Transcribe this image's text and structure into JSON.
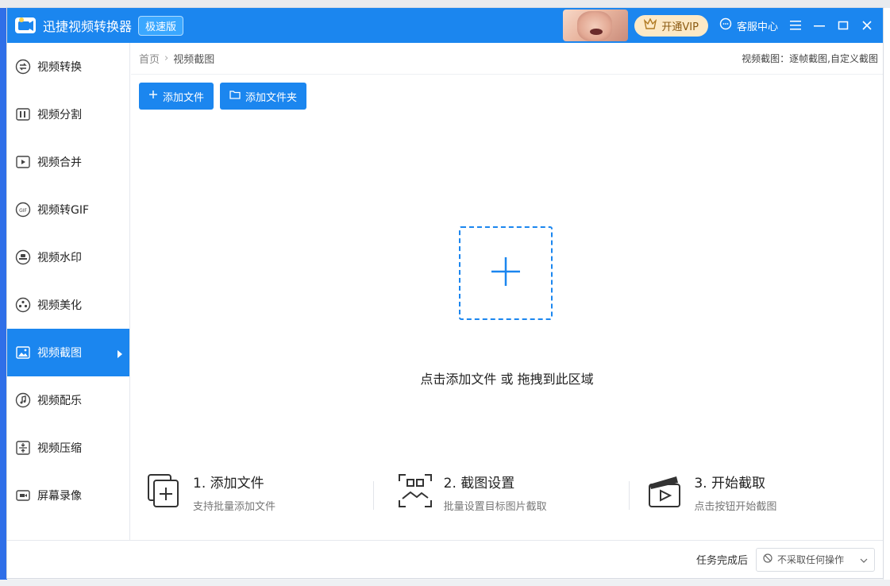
{
  "app": {
    "title": "迅捷视频转换器",
    "badge": "极速版",
    "vip_label": "开通VIP",
    "service_label": "客服中心"
  },
  "sidebar": {
    "items": [
      {
        "label": "视频转换",
        "icon": "convert-icon"
      },
      {
        "label": "视频分割",
        "icon": "split-icon"
      },
      {
        "label": "视频合并",
        "icon": "merge-icon"
      },
      {
        "label": "视频转GIF",
        "icon": "gif-icon"
      },
      {
        "label": "视频水印",
        "icon": "watermark-icon"
      },
      {
        "label": "视频美化",
        "icon": "beautify-icon"
      },
      {
        "label": "视频截图",
        "icon": "screenshot-icon",
        "active": true
      },
      {
        "label": "视频配乐",
        "icon": "music-icon"
      },
      {
        "label": "视频压缩",
        "icon": "compress-icon"
      },
      {
        "label": "屏幕录像",
        "icon": "record-icon"
      }
    ]
  },
  "breadcrumb": {
    "home": "首页",
    "current": "视频截图",
    "right_info": "视频截图：逐帧截图,自定义截图"
  },
  "toolbar": {
    "add_file": "添加文件",
    "add_folder": "添加文件夹"
  },
  "dropzone": {
    "text": "点击添加文件 或 拖拽到此区域"
  },
  "steps": [
    {
      "title": "1. 添加文件",
      "desc": "支持批量添加文件"
    },
    {
      "title": "2. 截图设置",
      "desc": "批量设置目标图片截取"
    },
    {
      "title": "3. 开始截取",
      "desc": "点击按钮开始截图"
    }
  ],
  "footer": {
    "label": "任务完成后",
    "select_value": "不采取任何操作"
  },
  "colors": {
    "accent": "#1b86ef",
    "vip_bg": "#fde9c6"
  }
}
